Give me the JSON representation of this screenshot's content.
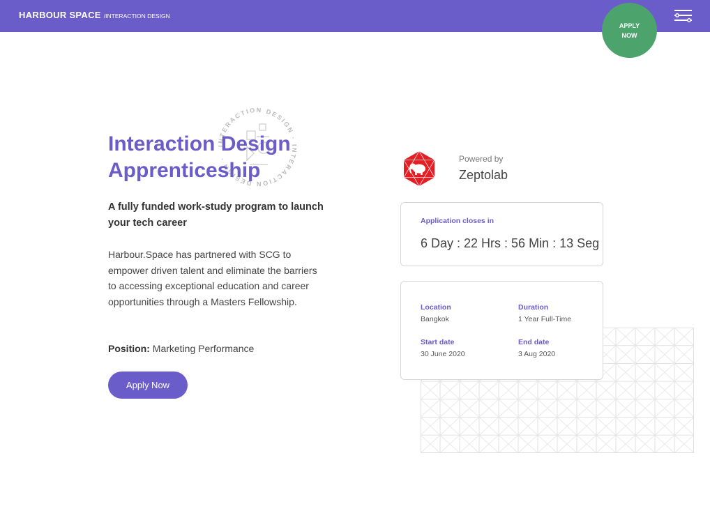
{
  "header": {
    "brand": "HARBOUR SPACE",
    "section": "/INTERACTION DESIGN",
    "apply_line1": "APPLY",
    "apply_line2": "NOW",
    "color": "#6a5cc9"
  },
  "badge": {
    "ring_text": "INTERACTION DESIGN · INTERACTION DESIGN · "
  },
  "hero": {
    "title_line1": "Interaction Design",
    "title_line2": "Apprenticeship",
    "subtitle": "A fully funded work-study program to launch your tech career",
    "description": "Harbour.Space has partnered with SCG to empower driven talent and eliminate the barriers to accessing exceptional education and career opportunities through a Masters Fellowship.",
    "position_label": "Position:",
    "position_value": "Marketing Performance",
    "apply_button": "Apply Now"
  },
  "sponsor": {
    "powered_by": "Powered by",
    "name": "Zeptolab",
    "logo_icon": "elephant-hexagon-icon",
    "logo_color": "#e31e24"
  },
  "countdown": {
    "label": "Application closes in",
    "value": "6 Day : 22 Hrs : 56 Min : 13 Seg"
  },
  "details": {
    "location_label": "Location",
    "location_value": "Bangkok",
    "duration_label": "Duration",
    "duration_value": "1 Year Full-Time",
    "start_label": "Start date",
    "start_value": "30 June 2020",
    "end_label": "End date",
    "end_value": "3 Aug 2020"
  },
  "colors": {
    "accent": "#6a5cc9",
    "apply_green": "#4ca36b"
  }
}
